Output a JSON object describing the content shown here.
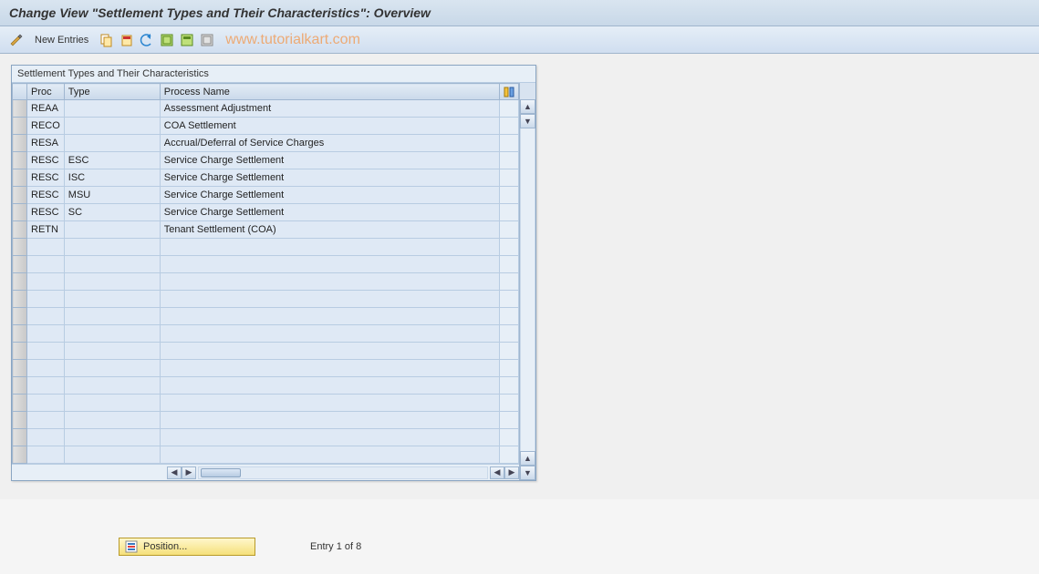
{
  "title": "Change View \"Settlement Types and Their Characteristics\": Overview",
  "toolbar": {
    "new_entries": "New Entries"
  },
  "watermark": "www.tutorialkart.com",
  "panel": {
    "caption": "Settlement Types and Their Characteristics",
    "columns": {
      "proc": "Proc",
      "type": "Type",
      "name": "Process Name"
    },
    "rows": [
      {
        "proc": "REAA",
        "type": "",
        "name": "Assessment Adjustment"
      },
      {
        "proc": "RECO",
        "type": "",
        "name": "COA Settlement"
      },
      {
        "proc": "RESA",
        "type": "",
        "name": "Accrual/Deferral of Service Charges"
      },
      {
        "proc": "RESC",
        "type": "ESC",
        "name": "Service Charge Settlement"
      },
      {
        "proc": "RESC",
        "type": "ISC",
        "name": "Service Charge Settlement"
      },
      {
        "proc": "RESC",
        "type": "MSU",
        "name": "Service Charge Settlement"
      },
      {
        "proc": "RESC",
        "type": "SC",
        "name": "Service Charge Settlement"
      },
      {
        "proc": "RETN",
        "type": "",
        "name": "Tenant Settlement (COA)"
      }
    ],
    "empty_rows": 13
  },
  "footer": {
    "position_label": "Position...",
    "entry_info": "Entry 1 of 8"
  }
}
